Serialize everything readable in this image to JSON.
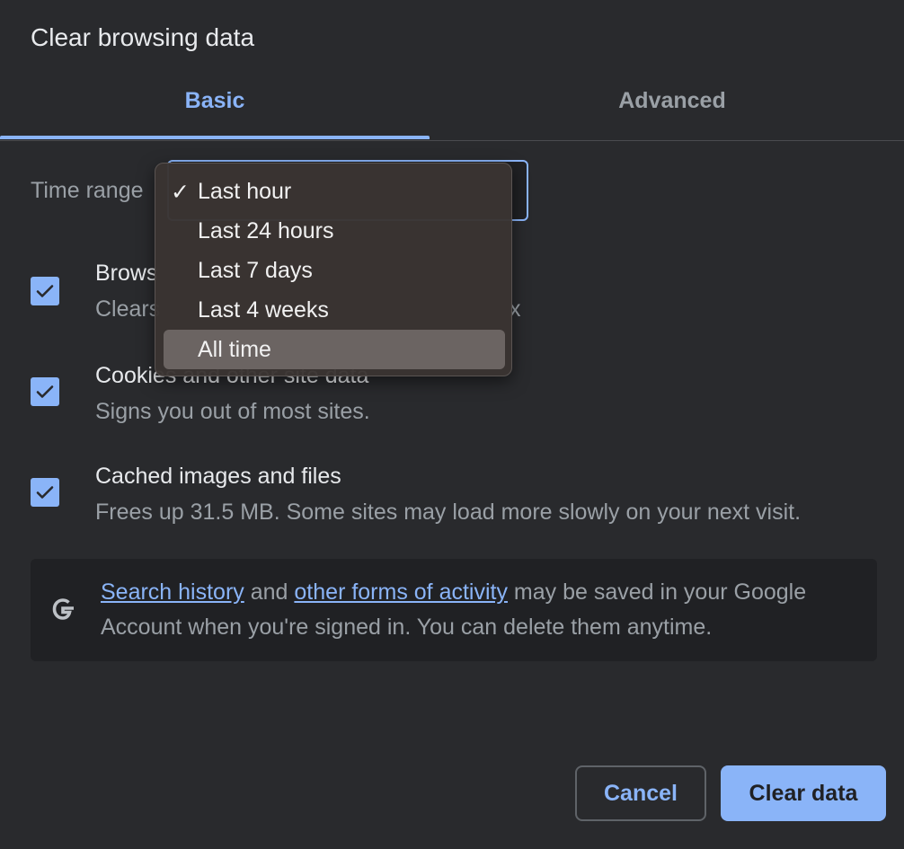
{
  "dialog": {
    "title": "Clear browsing data"
  },
  "tabs": [
    {
      "label": "Basic",
      "active": true
    },
    {
      "label": "Advanced",
      "active": false
    }
  ],
  "time_range": {
    "label": "Time range",
    "selected": "Last hour",
    "options": [
      "Last hour",
      "Last 24 hours",
      "Last 7 days",
      "Last 4 weeks",
      "All time"
    ],
    "highlighted": "All time",
    "checkmark": "✓"
  },
  "options": [
    {
      "title": "Brows",
      "desc": "Clears",
      "desc_trailing": "x",
      "checked": true
    },
    {
      "title": "Cookies and other site data",
      "desc": "Signs you out of most sites.",
      "checked": true
    },
    {
      "title": "Cached images and files",
      "desc": "Frees up 31.5 MB. Some sites may load more slowly on your next visit.",
      "checked": true
    }
  ],
  "info": {
    "link1": "Search history",
    "text1": " and ",
    "link2": "other forms of activity",
    "text2": " may be saved in your Google Account when you're signed in. You can delete them anytime.",
    "icon": "google-g-icon"
  },
  "buttons": {
    "cancel": "Cancel",
    "clear": "Clear data"
  },
  "colors": {
    "accent": "#8ab4f8",
    "background": "#292a2d",
    "panel": "#202124"
  }
}
